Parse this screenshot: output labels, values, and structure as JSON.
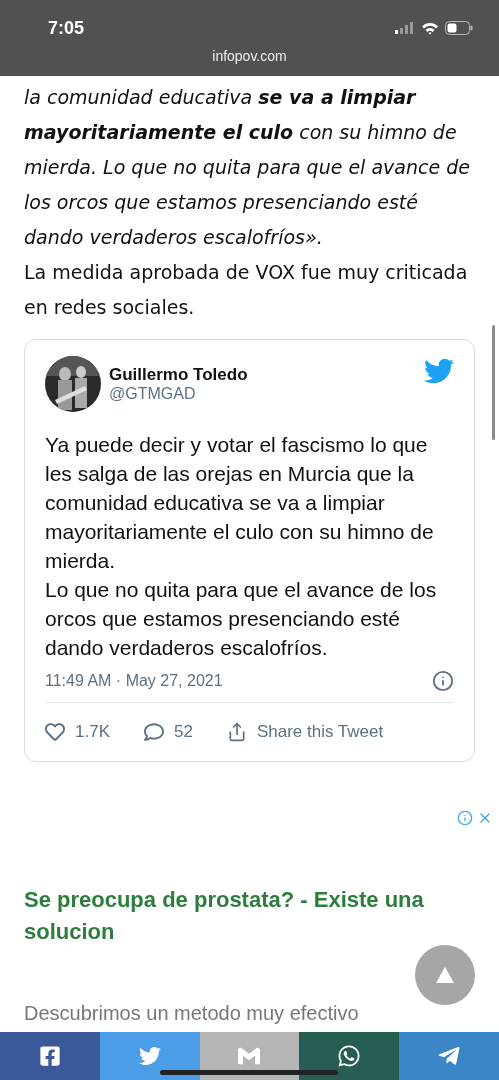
{
  "status_bar": {
    "time": "7:05"
  },
  "address_bar": {
    "url": "infopov.com"
  },
  "article": {
    "paragraphs": [
      {
        "kind": "quote",
        "text": "la comunidad educativa **se va a limpiar mayoritariamente el culo** con su himno de mierda. Lo que no quita para que el avance de los orcos que estamos presenciando esté dando verdaderos escalofríos»."
      },
      {
        "kind": "body",
        "text": "La medida aprobada de VOX fue muy criticada en redes sociales."
      }
    ]
  },
  "tweet": {
    "name": "Guillermo Toledo",
    "handle": "@GTMGAD",
    "text": "Ya puede decir y votar el fascismo lo que les salga de las orejas en Murcia que la comunidad educativa se va a limpiar mayoritariamente el culo con su himno de mierda.\nLo que no quita para que el avance de los orcos que estamos presenciando esté dando verdaderos escalofríos.",
    "timestamp": "11:49 AM · May 27, 2021",
    "likes": "1.7K",
    "replies": "52",
    "share_label": "Share this Tweet"
  },
  "ad": {
    "headline": "Se preocupa de prostata? - Existe una solucion",
    "body": "Descubrimos un metodo muy efectivo"
  },
  "share_bar": [
    {
      "kind": "facebook",
      "color": "#3b5998"
    },
    {
      "kind": "twitter",
      "color": "#4a9de6"
    },
    {
      "kind": "mail",
      "color": "#b5b5b5"
    },
    {
      "kind": "whatsapp",
      "color": "#275e53"
    },
    {
      "kind": "telegram",
      "color": "#3a86c8"
    }
  ]
}
